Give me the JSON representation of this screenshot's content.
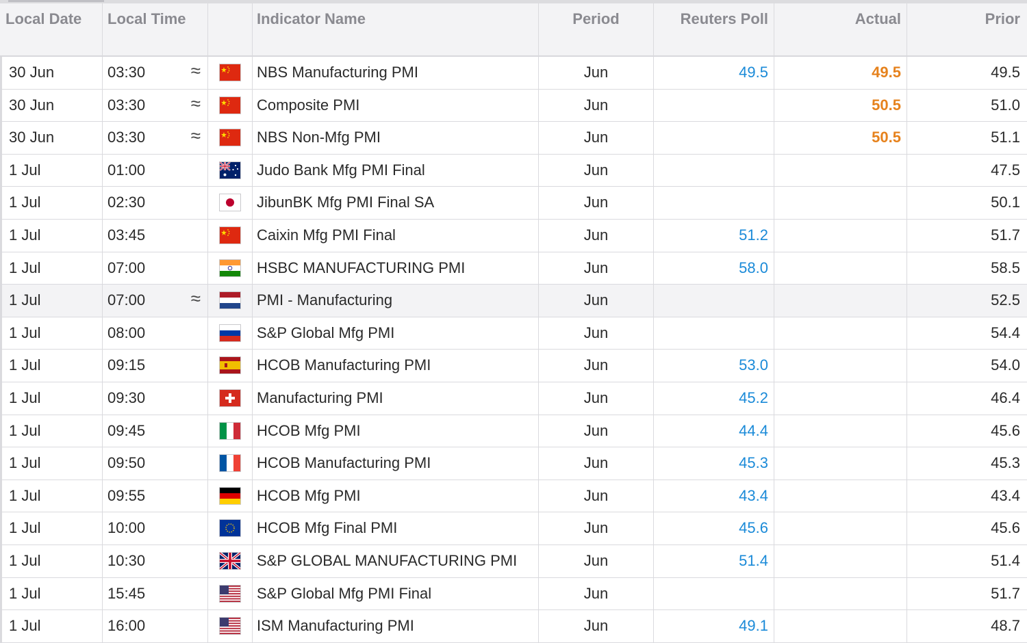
{
  "headers": {
    "date": "Local Date",
    "time": "Local Time",
    "name": "Indicator Name",
    "period": "Period",
    "poll": "Reuters Poll",
    "actual": "Actual",
    "prior": "Prior"
  },
  "rows": [
    {
      "date": "30 Jun",
      "time": "03:30",
      "approx": "≈",
      "flag": "cn",
      "name": "NBS Manufacturing PMI",
      "period": "Jun",
      "poll": "49.5",
      "actual": "49.5",
      "prior": "49.5"
    },
    {
      "date": "30 Jun",
      "time": "03:30",
      "approx": "≈",
      "flag": "cn",
      "name": "Composite PMI",
      "period": "Jun",
      "poll": "",
      "actual": "50.5",
      "prior": "51.0"
    },
    {
      "date": "30 Jun",
      "time": "03:30",
      "approx": "≈",
      "flag": "cn",
      "name": "NBS Non-Mfg PMI",
      "period": "Jun",
      "poll": "",
      "actual": "50.5",
      "prior": "51.1"
    },
    {
      "date": "1 Jul",
      "time": "01:00",
      "approx": "",
      "flag": "au",
      "name": "Judo Bank Mfg PMI Final",
      "period": "Jun",
      "poll": "",
      "actual": "",
      "prior": "47.5"
    },
    {
      "date": "1 Jul",
      "time": "02:30",
      "approx": "",
      "flag": "jp",
      "name": "JibunBK Mfg PMI Final SA",
      "period": "Jun",
      "poll": "",
      "actual": "",
      "prior": "50.1"
    },
    {
      "date": "1 Jul",
      "time": "03:45",
      "approx": "",
      "flag": "cn",
      "name": "Caixin Mfg PMI Final",
      "period": "Jun",
      "poll": "51.2",
      "actual": "",
      "prior": "51.7"
    },
    {
      "date": "1 Jul",
      "time": "07:00",
      "approx": "",
      "flag": "in",
      "name": "HSBC MANUFACTURING PMI",
      "period": "Jun",
      "poll": "58.0",
      "actual": "",
      "prior": "58.5"
    },
    {
      "date": "1 Jul",
      "time": "07:00",
      "approx": "≈",
      "flag": "nl",
      "name": "PMI - Manufacturing",
      "period": "Jun",
      "poll": "",
      "actual": "",
      "prior": "52.5"
    },
    {
      "date": "1 Jul",
      "time": "08:00",
      "approx": "",
      "flag": "ru",
      "name": "S&P Global Mfg PMI",
      "period": "Jun",
      "poll": "",
      "actual": "",
      "prior": "54.4"
    },
    {
      "date": "1 Jul",
      "time": "09:15",
      "approx": "",
      "flag": "es",
      "name": "HCOB Manufacturing PMI",
      "period": "Jun",
      "poll": "53.0",
      "actual": "",
      "prior": "54.0"
    },
    {
      "date": "1 Jul",
      "time": "09:30",
      "approx": "",
      "flag": "ch",
      "name": "Manufacturing PMI",
      "period": "Jun",
      "poll": "45.2",
      "actual": "",
      "prior": "46.4"
    },
    {
      "date": "1 Jul",
      "time": "09:45",
      "approx": "",
      "flag": "it",
      "name": "HCOB Mfg PMI",
      "period": "Jun",
      "poll": "44.4",
      "actual": "",
      "prior": "45.6"
    },
    {
      "date": "1 Jul",
      "time": "09:50",
      "approx": "",
      "flag": "fr",
      "name": "HCOB Manufacturing PMI",
      "period": "Jun",
      "poll": "45.3",
      "actual": "",
      "prior": "45.3"
    },
    {
      "date": "1 Jul",
      "time": "09:55",
      "approx": "",
      "flag": "de",
      "name": "HCOB Mfg PMI",
      "period": "Jun",
      "poll": "43.4",
      "actual": "",
      "prior": "43.4"
    },
    {
      "date": "1 Jul",
      "time": "10:00",
      "approx": "",
      "flag": "eu",
      "name": "HCOB Mfg Final PMI",
      "period": "Jun",
      "poll": "45.6",
      "actual": "",
      "prior": "45.6"
    },
    {
      "date": "1 Jul",
      "time": "10:30",
      "approx": "",
      "flag": "gb",
      "name": "S&P GLOBAL MANUFACTURING PMI",
      "period": "Jun",
      "poll": "51.4",
      "actual": "",
      "prior": "51.4"
    },
    {
      "date": "1 Jul",
      "time": "15:45",
      "approx": "",
      "flag": "us",
      "name": "S&P Global Mfg PMI Final",
      "period": "Jun",
      "poll": "",
      "actual": "",
      "prior": "51.7"
    },
    {
      "date": "1 Jul",
      "time": "16:00",
      "approx": "",
      "flag": "us",
      "name": "ISM Manufacturing PMI",
      "period": "Jun",
      "poll": "49.1",
      "actual": "",
      "prior": "48.7"
    }
  ],
  "highlight_row_index": 7,
  "colors": {
    "poll_blue": "#1a8ad8",
    "actual_orange": "#e6821d",
    "header_bg": "#f3f3f5",
    "header_text": "#8a8a90",
    "grid_line": "#dadade"
  }
}
